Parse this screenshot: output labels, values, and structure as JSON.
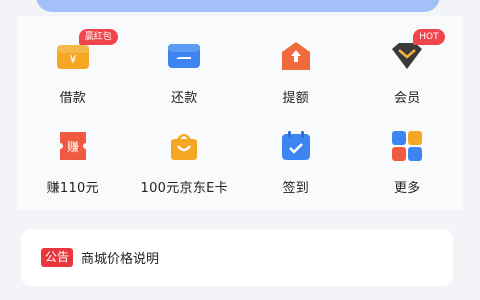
{
  "services": {
    "items": [
      {
        "label": "借款",
        "icon": "wallet-icon",
        "badge": "赢红包"
      },
      {
        "label": "还款",
        "icon": "card-icon",
        "badge": null
      },
      {
        "label": "提额",
        "icon": "arrow-up-house-icon",
        "badge": null
      },
      {
        "label": "会员",
        "icon": "diamond-icon",
        "badge": "HOT"
      },
      {
        "label": "赚110元",
        "icon": "coupon-icon",
        "badge": null
      },
      {
        "label": "100元京东E卡",
        "icon": "shopping-bag-icon",
        "badge": null
      },
      {
        "label": "签到",
        "icon": "calendar-check-icon",
        "badge": null
      },
      {
        "label": "更多",
        "icon": "grid-icon",
        "badge": null
      }
    ]
  },
  "notice": {
    "tag": "公告",
    "text": "商城价格说明"
  },
  "colors": {
    "accent_red": "#e8383d",
    "orange": "#f59a23",
    "blue": "#3d86f1"
  }
}
